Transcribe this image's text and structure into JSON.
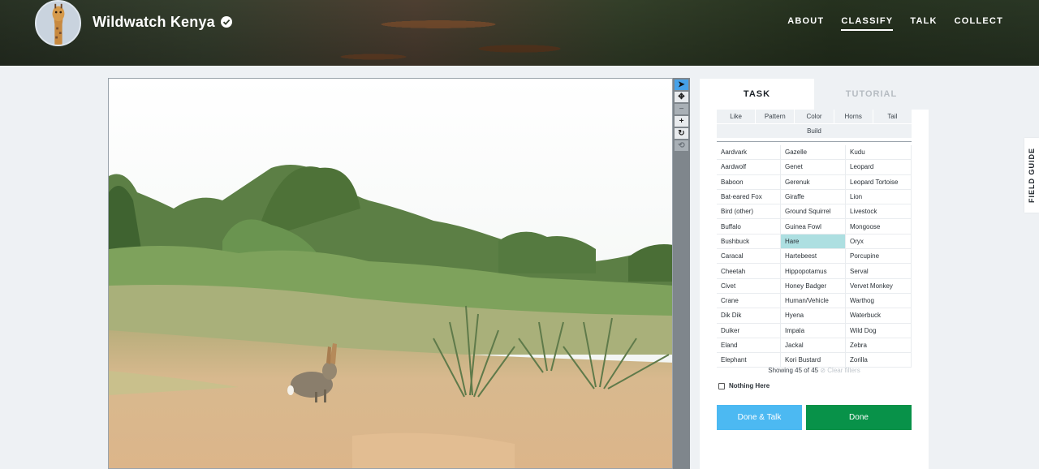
{
  "header": {
    "title": "Wildwatch Kenya",
    "nav": [
      {
        "label": "ABOUT",
        "active": false
      },
      {
        "label": "CLASSIFY",
        "active": true
      },
      {
        "label": "TALK",
        "active": false
      },
      {
        "label": "COLLECT",
        "active": false
      }
    ]
  },
  "tools": [
    {
      "icon": "pointer-icon",
      "glyph": "➤",
      "state": "active"
    },
    {
      "icon": "move-icon",
      "glyph": "✥",
      "state": "normal"
    },
    {
      "icon": "zoom-out-icon",
      "glyph": "−",
      "state": "disabled"
    },
    {
      "icon": "zoom-in-icon",
      "glyph": "+",
      "state": "normal"
    },
    {
      "icon": "rotate-icon",
      "glyph": "↻",
      "state": "normal"
    },
    {
      "icon": "reset-icon",
      "glyph": "⟲",
      "state": "disabled"
    }
  ],
  "panel": {
    "tabs": {
      "task": "TASK",
      "tutorial": "TUTORIAL"
    },
    "filters": [
      "Like",
      "Pattern",
      "Color",
      "Horns",
      "Tail",
      "Build"
    ],
    "species": [
      "Aardvark",
      "Gazelle",
      "Kudu",
      "Aardwolf",
      "Genet",
      "Leopard",
      "Baboon",
      "Gerenuk",
      "Leopard Tortoise",
      "Bat-eared Fox",
      "Giraffe",
      "Lion",
      "Bird (other)",
      "Ground Squirrel",
      "Livestock",
      "Buffalo",
      "Guinea Fowl",
      "Mongoose",
      "Bushbuck",
      "Hare",
      "Oryx",
      "Caracal",
      "Hartebeest",
      "Porcupine",
      "Cheetah",
      "Hippopotamus",
      "Serval",
      "Civet",
      "Honey Badger",
      "Vervet Monkey",
      "Crane",
      "Human/Vehicle",
      "Warthog",
      "Dik Dik",
      "Hyena",
      "Waterbuck",
      "Duiker",
      "Impala",
      "Wild Dog",
      "Eland",
      "Jackal",
      "Zebra",
      "Elephant",
      "Kori Bustard",
      "Zorilla"
    ],
    "selected_species": "Hare",
    "showing": "Showing 45 of 45",
    "clear_filters": "Clear filters",
    "nothing_here": "Nothing Here",
    "done_talk": "Done & Talk",
    "done": "Done"
  },
  "field_guide": "FIELD GUIDE",
  "colors": {
    "done_talk": "#4cb9f2",
    "done": "#089249",
    "selected": "#addfe1",
    "active_tool": "#46a1e8"
  }
}
